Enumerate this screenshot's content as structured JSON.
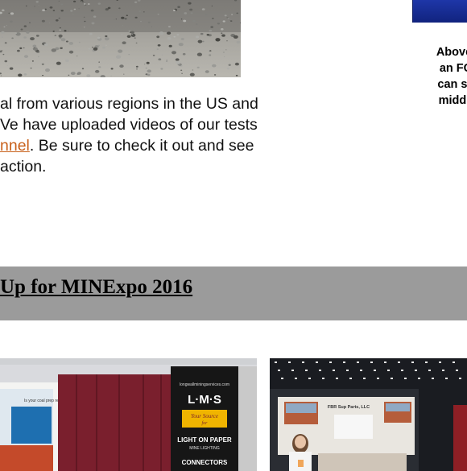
{
  "caption": {
    "lines": [
      "Above,",
      "an FC",
      "can se",
      "middli"
    ]
  },
  "paragraph": {
    "line1": "al from various regions in the US and",
    "line2": "Ve have uploaded videos of our tests",
    "line3_link": "nnel",
    "line3_rest": ". Be sure to check it out and see",
    "line4": "action."
  },
  "section": {
    "heading": "Up for MINExpo 2016"
  },
  "booth_sign": {
    "url": "longwallminingservices.com",
    "brand": "L·M·S",
    "tagline_1": "Your Source",
    "tagline_2": "for",
    "product_1": "LIGHT ON PAPER",
    "product_2": "MINE LIGHTING",
    "product_3": "CONNECTORS"
  },
  "left_poster": {
    "line1": "Is your coal prep ready?"
  },
  "right_booth": {
    "banner": "FBR Sup Parts, LLC"
  },
  "colors": {
    "link": "#c8601a",
    "heading_bar": "#9b9b9b",
    "sign_yellow": "#f0b400"
  }
}
